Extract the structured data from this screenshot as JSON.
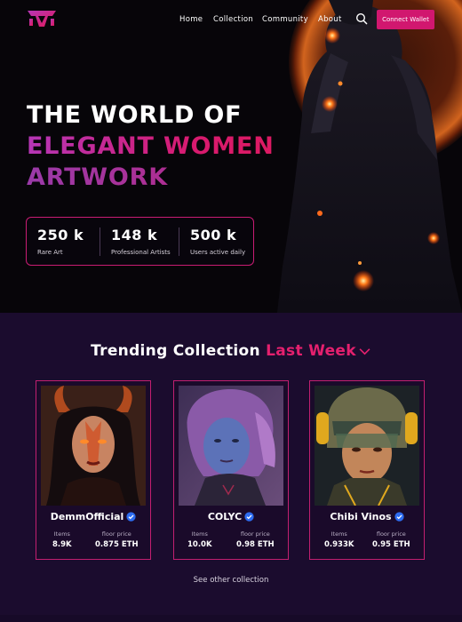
{
  "brand": {
    "logo_text": "",
    "accent": "#d1176f",
    "gradient": [
      "#b536b6",
      "#e0195a"
    ]
  },
  "nav": {
    "links": [
      "Home",
      "Collection",
      "Community",
      "About"
    ],
    "connect_label": "Connect Wallet"
  },
  "hero": {
    "title_line1": "THE WORLD OF",
    "title_line2": "ELEGANT WOMEN",
    "title_line3": "ARTWORK"
  },
  "stats": [
    {
      "value": "250 k",
      "label": "Rare Art"
    },
    {
      "value": "148 k",
      "label": "Professional Artists"
    },
    {
      "value": "500 k",
      "label": "Users active daily"
    }
  ],
  "trending": {
    "heading": "Trending Collection",
    "heading_accent": "Last Week",
    "see_other": "See other collection",
    "cards": [
      {
        "name": "DemmOfficial",
        "items_label": "Items",
        "items_value": "8.9K",
        "price_label": "floor price",
        "price_value": "0.875 ETH"
      },
      {
        "name": "COLYC",
        "items_label": "Items",
        "items_value": "10.0K",
        "price_label": "floor price",
        "price_value": "0.98 ETH"
      },
      {
        "name": "Chibi Vinos",
        "items_label": "Items",
        "items_value": "0.933K",
        "price_label": "floor price",
        "price_value": "0.95 ETH"
      }
    ]
  },
  "icons": {
    "search": "search-icon",
    "verified": "verified-badge-icon",
    "dropdown": "chevron-down-icon"
  }
}
